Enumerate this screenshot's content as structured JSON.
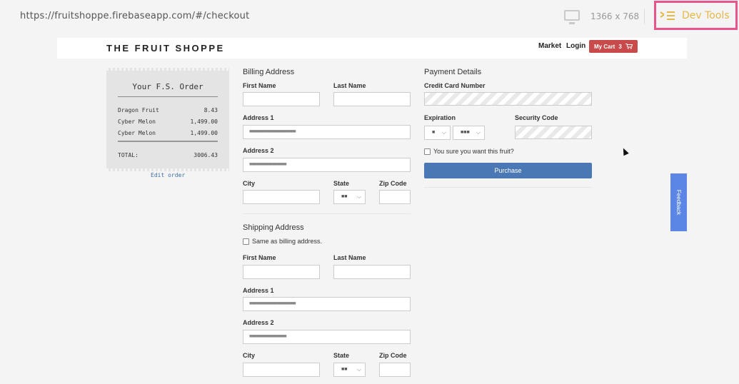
{
  "browser": {
    "url": "https://fruitshoppe.firebaseapp.com/#/checkout",
    "resolution": "1366 x 768",
    "devtools_label": "Dev Tools"
  },
  "header": {
    "brand": "THE FRUIT SHOPPE",
    "nav_market": "Market",
    "nav_login": "Login",
    "cart_label": "My Cart",
    "cart_count": "3"
  },
  "order": {
    "title": "Your F.S. Order",
    "items": [
      {
        "name": "Dragon Fruit",
        "price": "8.43"
      },
      {
        "name": "Cyber Melon",
        "price": "1,499.00"
      },
      {
        "name": "Cyber Melon",
        "price": "1,499.00"
      }
    ],
    "total_label": "TOTAL:",
    "total_value": "3006.43",
    "edit_link": "Edit order"
  },
  "billing": {
    "title": "Billing Address",
    "first_name_label": "First Name",
    "last_name_label": "Last Name",
    "address1_label": "Address 1",
    "address1_value": "■■■■■■■■■■■■■■■■■■■■",
    "address2_label": "Address 2",
    "address2_value": "■■■■■■■■■■■■■■■■",
    "city_label": "City",
    "state_label": "State",
    "state_value": "■■",
    "zip_label": "Zip Code"
  },
  "shipping": {
    "title": "Shipping Address",
    "same_as_billing": "Same as billing address.",
    "first_name_label": "First Name",
    "last_name_label": "Last Name",
    "address1_label": "Address 1",
    "address1_value": "■■■■■■■■■■■■■■■■■■■■",
    "address2_label": "Address 2",
    "address2_value": "■■■■■■■■■■■■■■■■",
    "city_label": "City",
    "state_label": "State",
    "state_value": "■■",
    "zip_label": "Zip Code"
  },
  "payment": {
    "title": "Payment Details",
    "card_label": "Credit Card Number",
    "expiration_label": "Expiration",
    "exp_month_value": "■",
    "exp_year_value": "■■■",
    "security_label": "Security Code",
    "confirm_label": "You sure you want this fruit?",
    "purchase_label": "Purchase"
  },
  "feedback_label": "Feedback",
  "colors": {
    "cart_red": "#c94a4a",
    "purchase_blue": "#4a78b5",
    "feedback_blue": "#5b86e5",
    "devtools_pink": "#e8558d",
    "devtools_gold": "#e6b84a"
  }
}
